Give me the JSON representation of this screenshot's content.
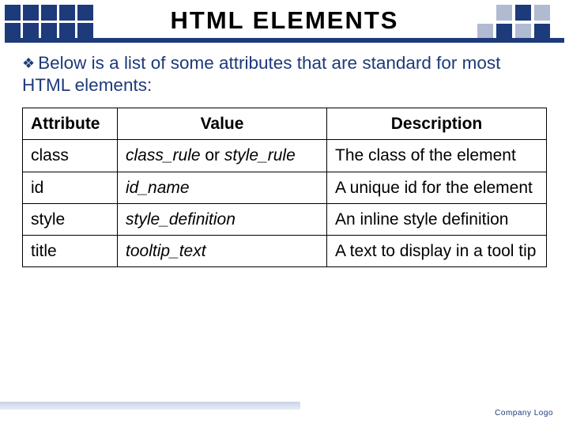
{
  "title": "HTML ELEMENTS",
  "bullet": {
    "text": "Below is a list of some attributes that are standard for most HTML elements:"
  },
  "table": {
    "headers": {
      "attr": "Attribute",
      "val": "Value",
      "desc": "Description"
    },
    "rows": [
      {
        "attr": "class",
        "val_italic": "class_rule",
        "val_mid": " or ",
        "val_italic2": "style_rule",
        "desc": "The class of the element"
      },
      {
        "attr": "id",
        "val_italic": "id_name",
        "desc": "A unique id for the element"
      },
      {
        "attr": "style",
        "val_italic": "style_definition",
        "desc": "An inline style definition"
      },
      {
        "attr": "title",
        "val_italic": "tooltip_text",
        "desc": "A text to display in a tool tip"
      }
    ]
  },
  "footer": "Company Logo"
}
